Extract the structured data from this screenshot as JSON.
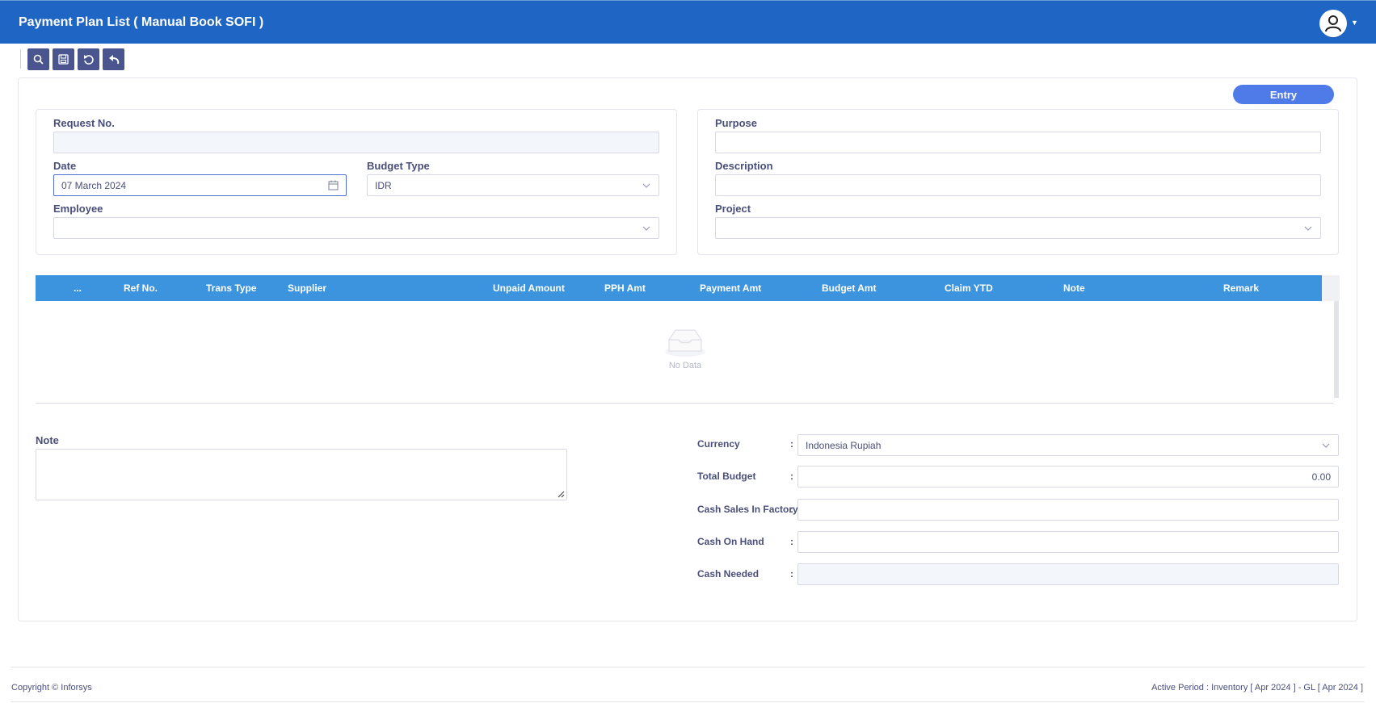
{
  "header": {
    "title": "Payment Plan List ( Manual Book SOFI )"
  },
  "toolbar": {
    "buttons": [
      "search-icon",
      "save-icon",
      "refresh-icon",
      "undo-icon"
    ]
  },
  "status": {
    "badge": "Entry"
  },
  "form_left": {
    "request_no_label": "Request No.",
    "request_no_value": "",
    "date_label": "Date",
    "date_value": "07 March 2024",
    "budget_type_label": "Budget Type",
    "budget_type_value": "IDR",
    "employee_label": "Employee",
    "employee_value": ""
  },
  "form_right": {
    "purpose_label": "Purpose",
    "purpose_value": "",
    "description_label": "Description",
    "description_value": "",
    "project_label": "Project",
    "project_value": ""
  },
  "grid": {
    "columns": [
      "...",
      "Ref No.",
      "Trans Type",
      "Supplier",
      "Unpaid Amount",
      "PPH Amt",
      "Payment Amt",
      "Budget Amt",
      "Claim YTD",
      "Note",
      "Remark"
    ],
    "rows": [],
    "empty_text": "No Data"
  },
  "note": {
    "label": "Note",
    "value": ""
  },
  "summary": {
    "currency_label": "Currency",
    "currency_value": "Indonesia Rupiah",
    "total_budget_label": "Total Budget",
    "total_budget_value": "0.00",
    "cash_sales_label": "Cash Sales In Factory",
    "cash_sales_value": "",
    "cash_on_hand_label": "Cash On Hand",
    "cash_on_hand_value": "",
    "cash_needed_label": "Cash Needed",
    "cash_needed_value": "",
    "separator": ":"
  },
  "footer": {
    "copyright": "Copyright © Inforsys",
    "active_period": "Active Period  :  Inventory [ Apr 2024 ]  -  GL [ Apr 2024 ]"
  },
  "colors": {
    "header_bg": "#1f65c4",
    "grid_header": "#3d94de",
    "toolbar_button": "#4a5590",
    "badge": "#4f7be8"
  }
}
